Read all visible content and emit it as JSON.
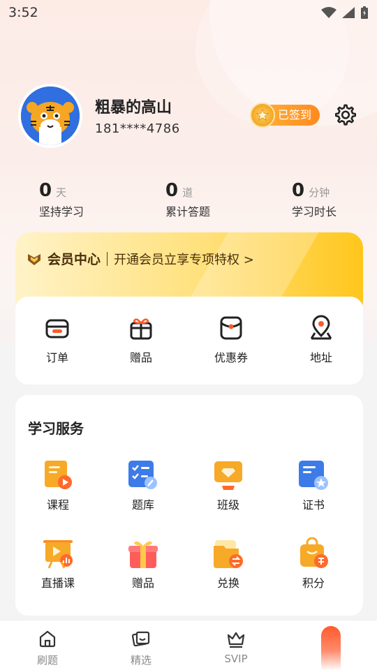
{
  "status_bar": {
    "time": "3:52"
  },
  "profile": {
    "username": "粗暴的高山",
    "phone": "181****4786",
    "checkin_label": "已签到"
  },
  "stats": [
    {
      "value": "0",
      "unit": "天",
      "label": "坚持学习"
    },
    {
      "value": "0",
      "unit": "道",
      "label": "累计答题"
    },
    {
      "value": "0",
      "unit": "分钟",
      "label": "学习时长"
    }
  ],
  "vip": {
    "title": "会员中心",
    "description": "开通会员立享专项特权 >"
  },
  "quick_actions": [
    {
      "label": "订单",
      "icon": "order-icon"
    },
    {
      "label": "赠品",
      "icon": "gift-icon"
    },
    {
      "label": "优惠券",
      "icon": "coupon-icon"
    },
    {
      "label": "地址",
      "icon": "location-icon"
    }
  ],
  "services": {
    "title": "学习服务",
    "items": [
      {
        "label": "课程",
        "icon": "course-icon"
      },
      {
        "label": "题库",
        "icon": "question-bank-icon"
      },
      {
        "label": "班级",
        "icon": "class-icon"
      },
      {
        "label": "证书",
        "icon": "certificate-icon"
      },
      {
        "label": "直播课",
        "icon": "live-class-icon"
      },
      {
        "label": "赠品",
        "icon": "gift-box-icon"
      },
      {
        "label": "兑换",
        "icon": "exchange-icon"
      },
      {
        "label": "积分",
        "icon": "points-icon"
      }
    ]
  },
  "tabbar": [
    {
      "label": "刷题",
      "icon": "home-icon"
    },
    {
      "label": "精选",
      "icon": "featured-icon"
    },
    {
      "label": "SVIP",
      "icon": "crown-icon"
    }
  ],
  "colors": {
    "accent": "#ff8a1f",
    "vip_gold": "#ffc61c",
    "brand_blue": "#2f6fe0"
  }
}
